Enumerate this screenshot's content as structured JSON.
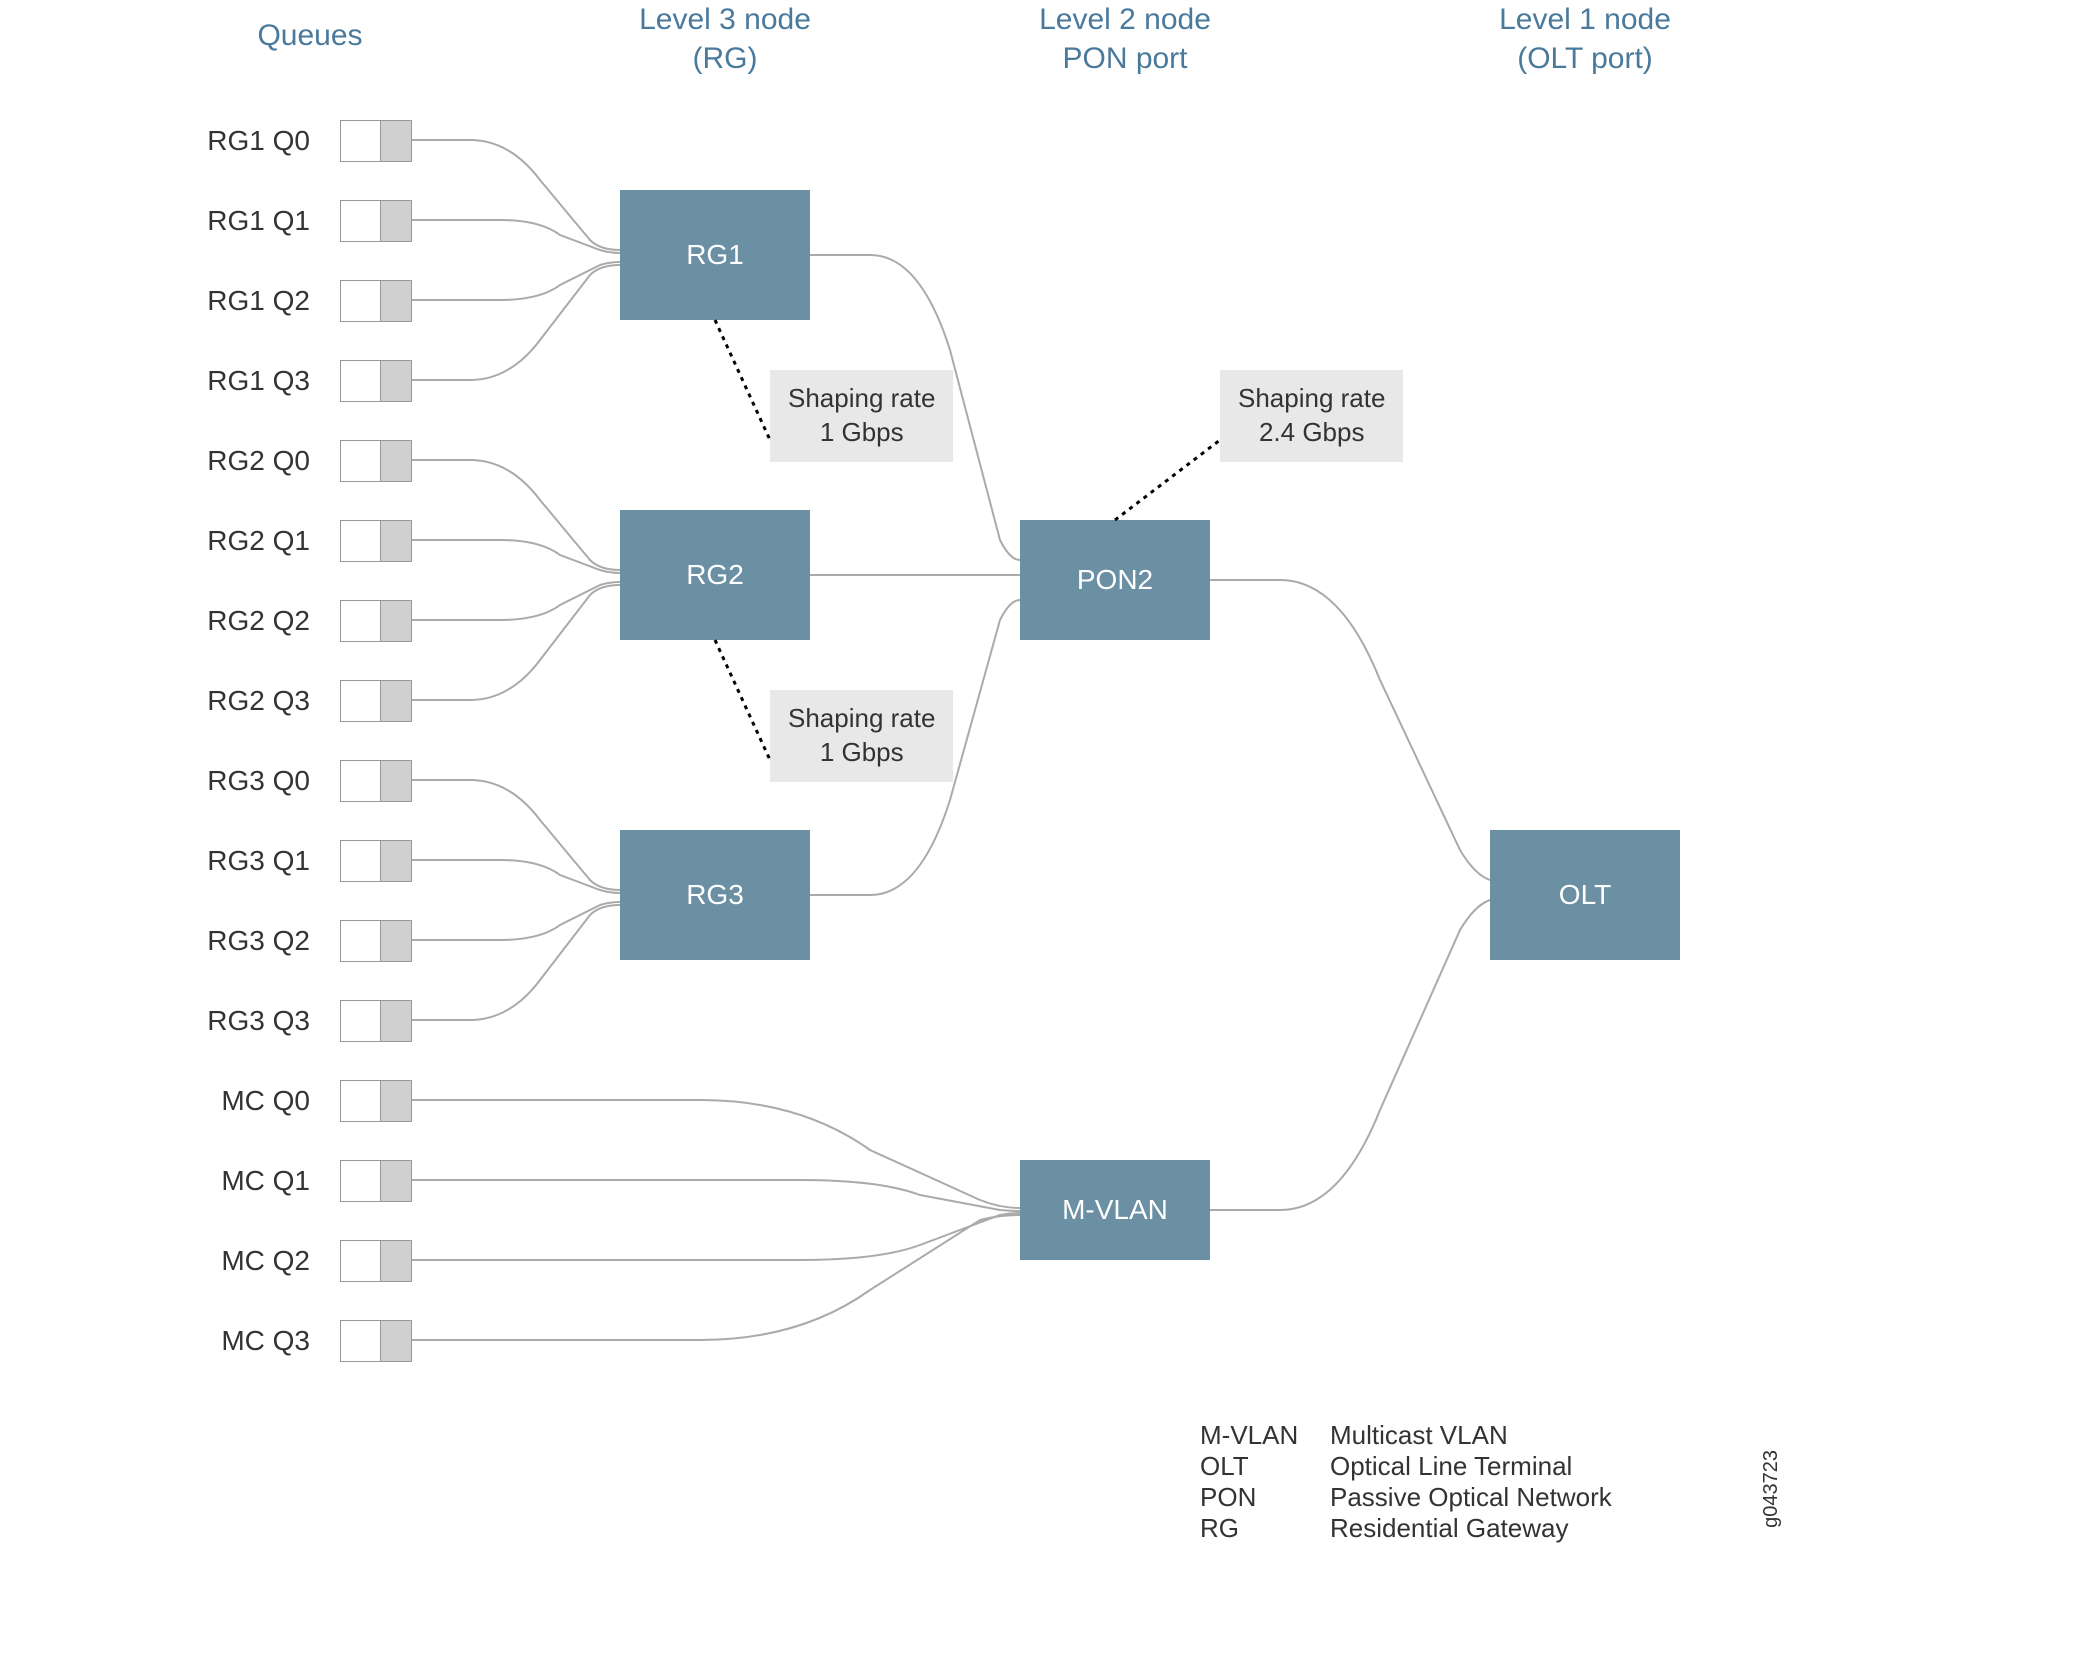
{
  "headers": {
    "queues": "Queues",
    "level3_line1": "Level 3 node",
    "level3_line2": "(RG)",
    "level2_line1": "Level 2 node",
    "level2_line2": "PON port",
    "level1_line1": "Level 1 node",
    "level1_line2": "(OLT port)"
  },
  "queues": [
    "RG1 Q0",
    "RG1 Q1",
    "RG1 Q2",
    "RG1 Q3",
    "RG2 Q0",
    "RG2 Q1",
    "RG2 Q2",
    "RG2 Q3",
    "RG3 Q0",
    "RG3 Q1",
    "RG3 Q2",
    "RG3 Q3",
    "MC Q0",
    "MC Q1",
    "MC Q2",
    "MC Q3"
  ],
  "nodes": {
    "rg1": "RG1",
    "rg2": "RG2",
    "rg3": "RG3",
    "pon2": "PON2",
    "mvlan": "M-VLAN",
    "olt": "OLT"
  },
  "annotations": {
    "shaping_rg12_line1": "Shaping rate",
    "shaping_rg12_line2": "1 Gbps",
    "shaping_rg23_line1": "Shaping rate",
    "shaping_rg23_line2": "1 Gbps",
    "shaping_pon_line1": "Shaping rate",
    "shaping_pon_line2": "2.4 Gbps"
  },
  "legend": {
    "mvlan_term": "M-VLAN",
    "mvlan_def": "Multicast VLAN",
    "olt_term": "OLT",
    "olt_def": "Optical  Line Terminal",
    "pon_term": "PON",
    "pon_def": "Passive Optical Network",
    "rg_term": "RG",
    "rg_def": "Residential Gateway"
  },
  "figure_id": "g043723"
}
